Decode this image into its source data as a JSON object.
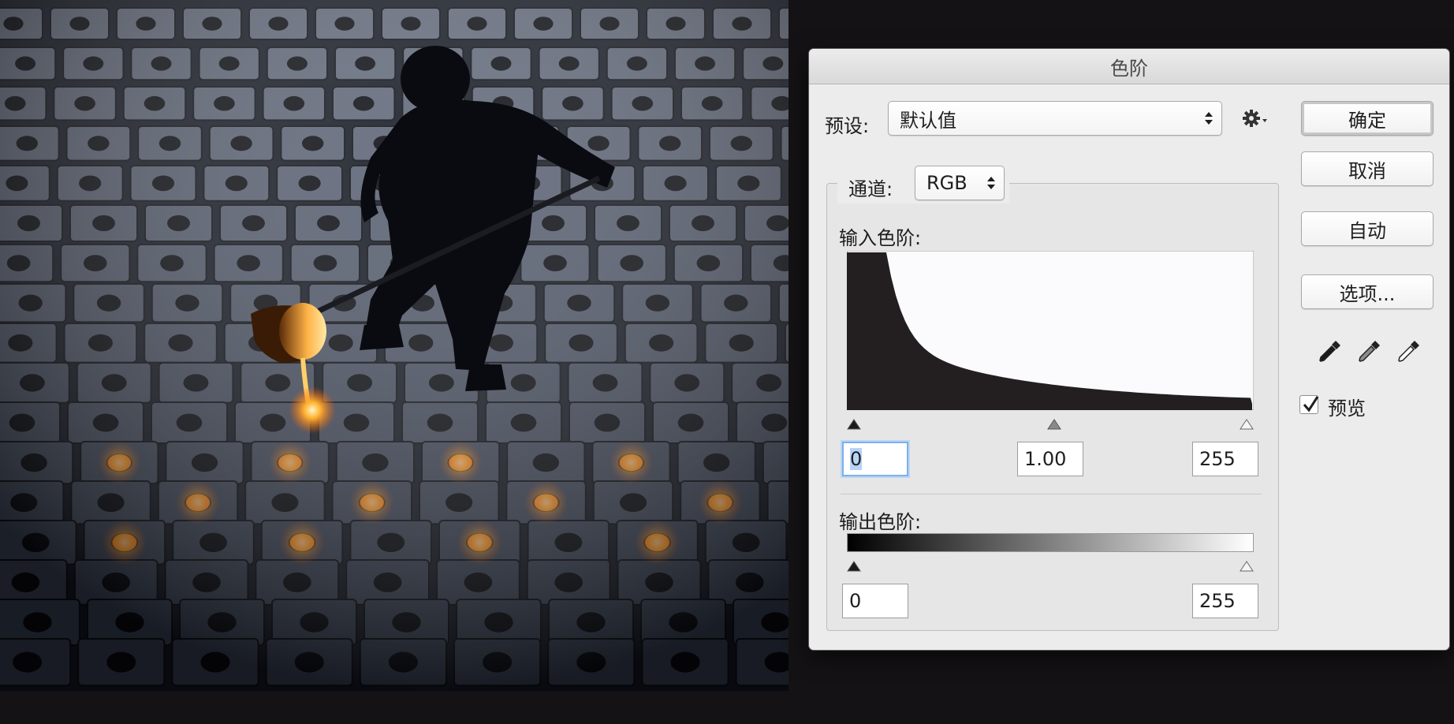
{
  "dialog": {
    "title": "色阶",
    "preset_label": "预设:",
    "preset_value": "默认值",
    "channel_label": "通道:",
    "channel_value": "RGB",
    "input_levels_label": "输入色阶:",
    "output_levels_label": "输出色阶:",
    "input_black": "0",
    "input_gamma": "1.00",
    "input_white": "255",
    "output_black": "0",
    "output_white": "255",
    "buttons": {
      "ok": "确定",
      "cancel": "取消",
      "auto": "自动",
      "options": "选项..."
    },
    "preview_label": "预览",
    "preview_checked": true
  },
  "icons": [
    "gear-icon",
    "popup-arrows-icon",
    "black-point-eyedropper-icon",
    "gray-point-eyedropper-icon",
    "white-point-eyedropper-icon",
    "checkmark-icon"
  ],
  "colors": {
    "dialog_bg": "#ececec",
    "histogram_fill": "#231f20",
    "focus_ring": "#7cb0ec",
    "molten_metal": "#ff9a2a"
  }
}
